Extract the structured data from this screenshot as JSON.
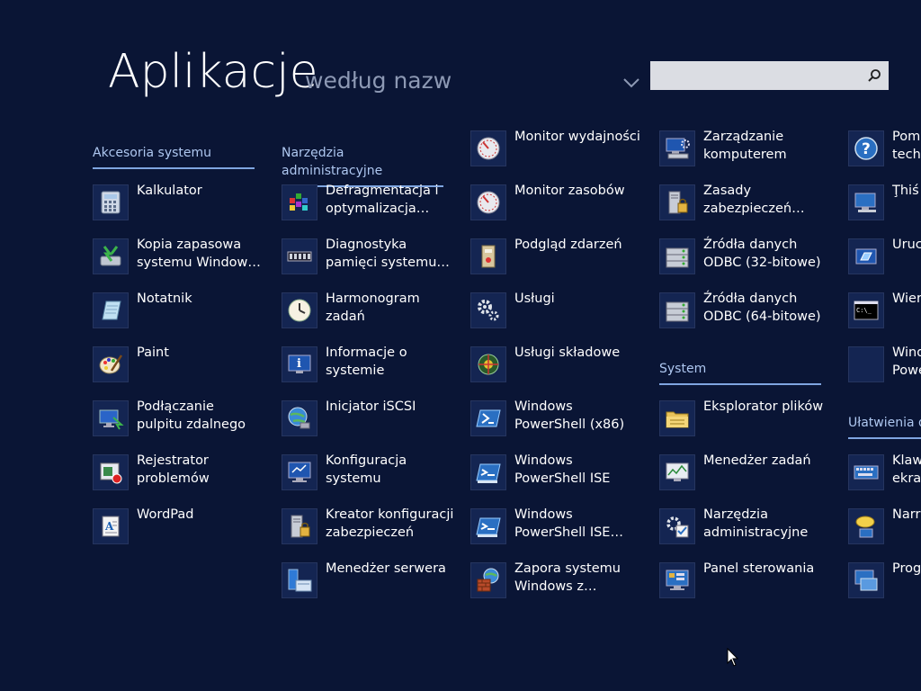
{
  "header": {
    "title": "Aplikacje",
    "subtitle": "według nazw",
    "search_placeholder": ""
  },
  "groups": {
    "akcesoria": "Akcesoria systemu",
    "narzedzia": "Narzędzia administracyjne",
    "system": "System",
    "ulatwienia": "Ułatwienia d"
  },
  "col1": [
    {
      "label": "Kalkulator",
      "icon": "calculator-icon"
    },
    {
      "label": "Kopia zapasowa\nsystemu Window…",
      "icon": "backup-icon"
    },
    {
      "label": "Notatnik",
      "icon": "notepad-icon"
    },
    {
      "label": "Paint",
      "icon": "paint-icon"
    },
    {
      "label": "Podłączanie\npulpitu zdalnego",
      "icon": "remote-desktop-icon"
    },
    {
      "label": "Rejestrator\nproblemów",
      "icon": "steps-recorder-icon"
    },
    {
      "label": "WordPad",
      "icon": "wordpad-icon"
    }
  ],
  "col2": [
    {
      "label": "Defragmentacja i\noptymalizacja…",
      "icon": "defrag-icon"
    },
    {
      "label": "Diagnostyka\npamięci systemu…",
      "icon": "memory-icon"
    },
    {
      "label": "Harmonogram\nzadań",
      "icon": "clock-icon"
    },
    {
      "label": "Informacje o\nsystemie",
      "icon": "system-info-icon"
    },
    {
      "label": "Inicjator iSCSI",
      "icon": "globe-icon"
    },
    {
      "label": "Konfiguracja\nsystemu",
      "icon": "monitor-icon"
    },
    {
      "label": "Kreator konfiguracji\nzabezpieczeń",
      "icon": "tower-lock-icon"
    },
    {
      "label": "Menedżer serwera",
      "icon": "server-manager-icon"
    }
  ],
  "col3": [
    {
      "label": "Monitor wydajności",
      "icon": "gauge-icon"
    },
    {
      "label": "Monitor zasobów",
      "icon": "gauge-icon"
    },
    {
      "label": "Podgląd zdarzeń",
      "icon": "event-viewer-icon"
    },
    {
      "label": "Usługi",
      "icon": "gears-icon"
    },
    {
      "label": "Usługi składowe",
      "icon": "component-services-icon"
    },
    {
      "label": "Windows\nPowerShell (x86)",
      "icon": "powershell-icon"
    },
    {
      "label": "Windows\nPowerShell ISE",
      "icon": "powershell-ise-icon"
    },
    {
      "label": "Windows\nPowerShell ISE…",
      "icon": "powershell-ise-icon"
    },
    {
      "label": "Zapora systemu\nWindows z…",
      "icon": "firewall-icon"
    }
  ],
  "col4": [
    {
      "label": "Zarządzanie\nkomputerem",
      "icon": "computer-management-icon"
    },
    {
      "label": "Zasady\nzabezpieczeń…",
      "icon": "tower-lock-icon"
    },
    {
      "label": "Źródła danych\nODBC (32-bitowe)",
      "icon": "odbc-icon"
    },
    {
      "label": "Źródła danych\nODBC (64-bitowe)",
      "icon": "odbc-icon"
    }
  ],
  "col4_system": [
    {
      "label": "Eksplorator plików",
      "icon": "folder-icon"
    },
    {
      "label": "Menedżer zadań",
      "icon": "task-manager-icon"
    },
    {
      "label": "Narzędzia\nadministracyjne",
      "icon": "admin-tools-icon"
    },
    {
      "label": "Panel sterowania",
      "icon": "control-panel-icon"
    }
  ],
  "col5": [
    {
      "label": "Pomo\ntechn",
      "icon": "help-icon"
    },
    {
      "label": "Ţhiś",
      "icon": "this-pc-icon"
    },
    {
      "label": "Uruc",
      "icon": "run-icon"
    },
    {
      "label": "Wiers",
      "icon": "cmd-icon"
    },
    {
      "label": "Wind\nPowe",
      "icon": "blank-icon"
    }
  ],
  "col5_ulatwienia": [
    {
      "label": "Klawi\nekran",
      "icon": "keyboard-icon"
    },
    {
      "label": "Narra",
      "icon": "narrator-icon"
    },
    {
      "label": "Prog",
      "icon": "program-icon"
    }
  ]
}
